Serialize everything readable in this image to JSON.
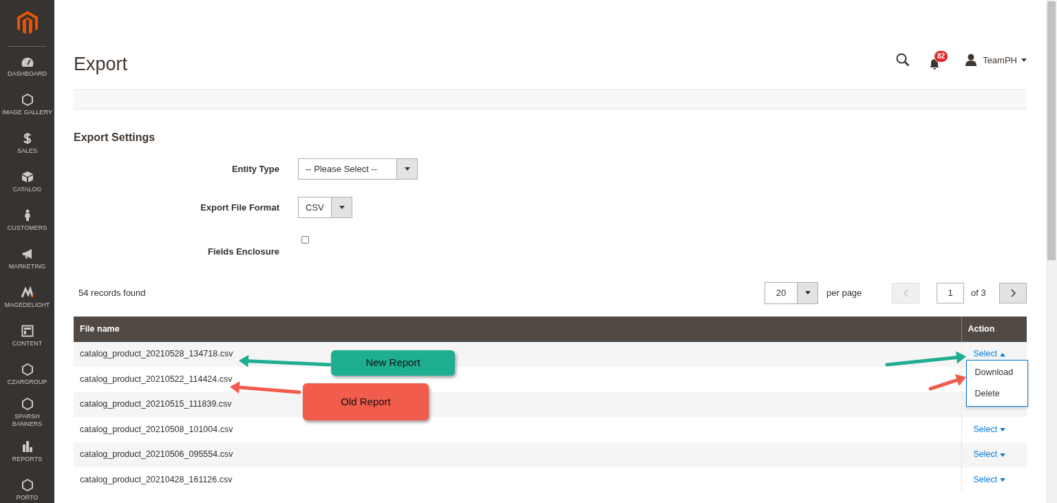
{
  "sidebar": {
    "items": [
      {
        "label": "DASHBOARD"
      },
      {
        "label": "IMAGE GALLERY"
      },
      {
        "label": "SALES"
      },
      {
        "label": "CATALOG"
      },
      {
        "label": "CUSTOMERS"
      },
      {
        "label": "MARKETING"
      },
      {
        "label": "MAGEDELIGHT"
      },
      {
        "label": "CONTENT"
      },
      {
        "label": "CZARGROUP"
      },
      {
        "label": "SPARSH BANNERS"
      },
      {
        "label": "REPORTS"
      },
      {
        "label": "PORTO"
      }
    ]
  },
  "header": {
    "title": "Export",
    "notifications": "82",
    "user": "TeamPH"
  },
  "settings": {
    "title": "Export Settings",
    "fields": [
      {
        "kind": "select",
        "label": "Entity Type",
        "value": "-- Please Select --"
      },
      {
        "kind": "select",
        "label": "Export File Format",
        "value": "CSV"
      },
      {
        "kind": "checkbox",
        "label": "Fields Enclosure",
        "checked": false
      }
    ]
  },
  "grid": {
    "records": "54 records found",
    "per_page": "20",
    "per_page_label": "per page",
    "page": "1",
    "of_pages": "of 3",
    "prev_disabled": true,
    "columns": [
      "File name",
      "Action"
    ],
    "rows": [
      {
        "file": "catalog_product_20210528_134718.csv",
        "action": "Select",
        "expanded": true,
        "menu": [
          "Download",
          "Delete"
        ]
      },
      {
        "file": "catalog_product_20210522_114424.csv"
      },
      {
        "file": "catalog_product_20210515_111839.csv"
      },
      {
        "file": "catalog_product_20210508_101004.csv",
        "action": "Select",
        "expanded": false
      },
      {
        "file": "catalog_product_20210506_095554.csv",
        "action": "Select",
        "expanded": false
      },
      {
        "file": "catalog_product_20210428_161126.csv",
        "action": "Select",
        "expanded": false
      }
    ]
  },
  "annotations": [
    {
      "text": "New Report",
      "color": "#1fae91"
    },
    {
      "text": "Old Report",
      "color": "#f25c4c"
    }
  ]
}
